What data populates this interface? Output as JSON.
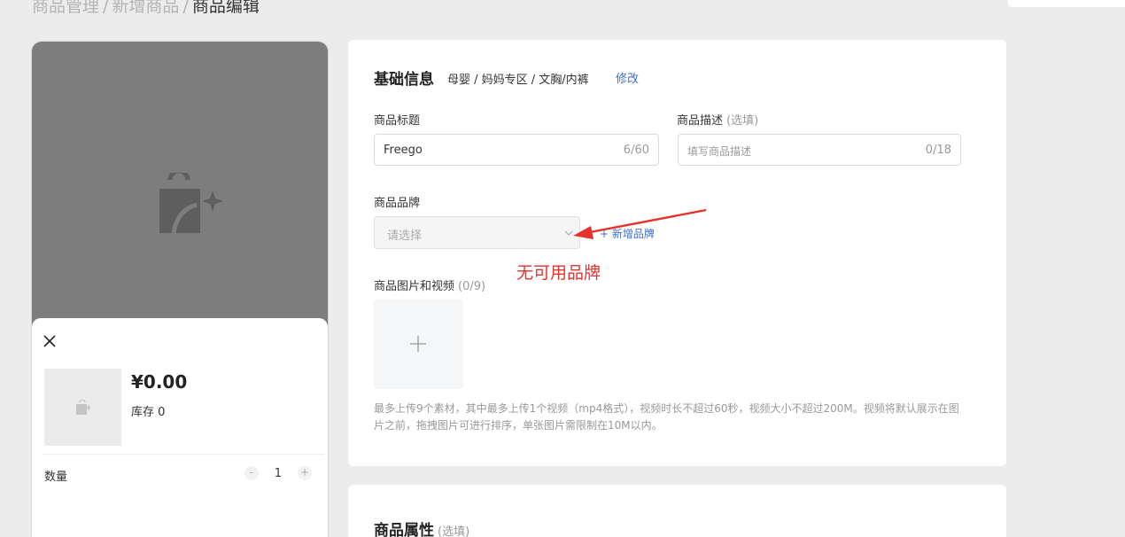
{
  "breadcrumb": {
    "items": [
      "商品管理",
      "新增商品"
    ],
    "current": "商品编辑",
    "separator": "/"
  },
  "preview": {
    "price": "¥0.00",
    "stock": "库存 0",
    "quantity_label": "数量",
    "quantity_value": "1",
    "minus": "-",
    "plus": "+"
  },
  "basic_info": {
    "title": "基础信息",
    "category": "母婴 / 妈妈专区 / 文胸/内裤",
    "edit_label": "修改",
    "product_title_label": "商品标题",
    "product_title_value": "Freego",
    "product_title_counter": "6/60",
    "description_label": "商品描述",
    "description_optional": "(选填)",
    "description_placeholder": "填写商品描述",
    "description_counter": "0/18",
    "brand_label": "商品品牌",
    "brand_placeholder": "请选择",
    "add_brand": "+ 新增品牌",
    "annotation": "无可用品牌",
    "media_label": "商品图片和视频",
    "media_counter": "(0/9)",
    "media_hint": "最多上传9个素材，其中最多上传1个视频（mp4格式），视频时长不超过60秒，视频大小不超过200M。视频将默认展示在图片之前，拖拽图片可进行排序，单张图片需限制在10M以内。"
  },
  "attributes": {
    "title": "商品属性",
    "optional": "(选填)"
  },
  "colors": {
    "accent": "#3d6fd6",
    "annotation": "#e5322d",
    "background": "#ececec"
  }
}
